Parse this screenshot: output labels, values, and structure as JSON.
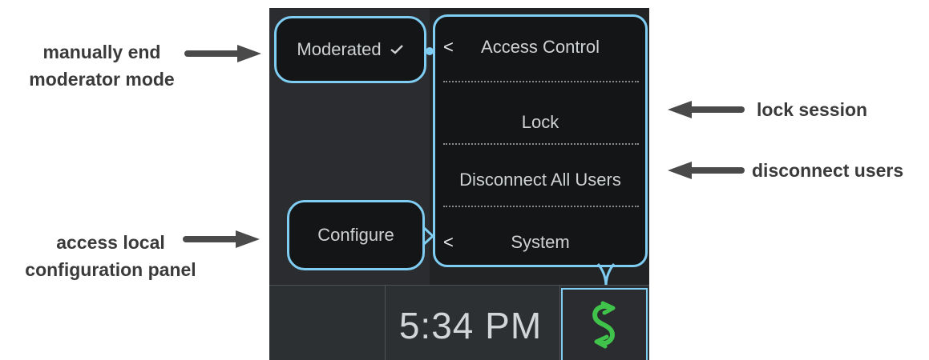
{
  "callouts": {
    "end_moderator": [
      "manually end",
      "moderator mode"
    ],
    "local_config": [
      "access local",
      "configuration panel"
    ],
    "lock_session": "lock session",
    "disconnect_users": "disconnect users"
  },
  "moderated_button": {
    "label": "Moderated",
    "check_icon": "checkmark-icon"
  },
  "configure_button": {
    "label": "Configure"
  },
  "menu": {
    "items": [
      {
        "label": "Access Control",
        "chevron": "<"
      },
      {
        "label": "Lock"
      },
      {
        "label": "Disconnect All Users"
      },
      {
        "label": "System",
        "chevron": "<"
      }
    ]
  },
  "taskbar": {
    "time": "5:34 PM",
    "logo_icon": "solstice-logo-icon"
  },
  "colors": {
    "highlight": "#7fcdf2",
    "screen_bg": "#2a2c2f",
    "bubble_bg": "#141516",
    "logo_green": "#3fc34a",
    "callout_text": "#3a3a3a"
  }
}
